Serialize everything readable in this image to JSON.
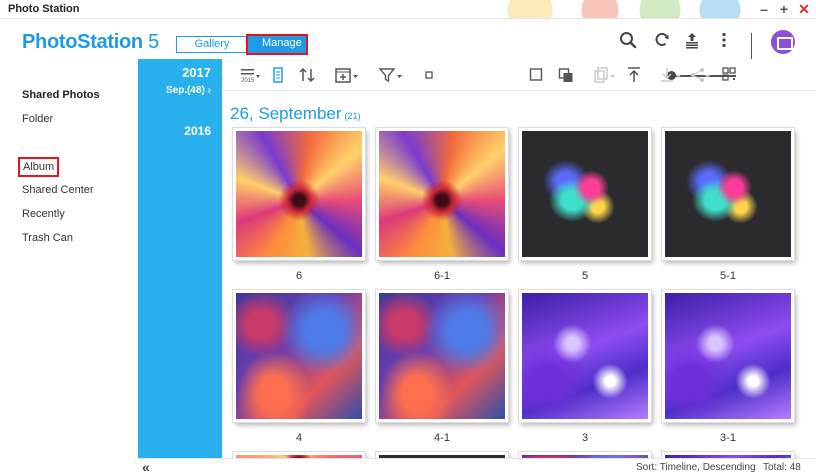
{
  "window": {
    "title": "Photo Station",
    "controls": [
      "–",
      "+",
      "✕"
    ]
  },
  "header": {
    "logo_bold": "PhotoStation",
    "logo_rest": " 5",
    "mode_gallery": "Gallery",
    "mode_manage": "Manage",
    "icons": [
      "search-icon",
      "refresh-icon",
      "upload-icon",
      "more-icon",
      "user-avatar-icon"
    ]
  },
  "sidebar": {
    "items": [
      {
        "label": "Shared Photos"
      },
      {
        "label": "Folder"
      },
      {
        "label": "Album"
      },
      {
        "label": "Shared Center"
      },
      {
        "label": "Recently"
      },
      {
        "label": "Trash Can"
      }
    ]
  },
  "timeline": {
    "year_current": "2017",
    "month_current": "Sep.(48) ›",
    "year_prev": "2016"
  },
  "toolbar": {
    "icons": [
      "date-sort-icon",
      "list-view-icon",
      "sort-order-icon",
      "add-to-album-icon",
      "filter-icon",
      "small-thumb-icon",
      "zoom-slider",
      "large-thumb-icon",
      "multi-select-icon",
      "copy-icon",
      "upload-top-icon",
      "download-icon",
      "share-icon",
      "qr-code-icon"
    ],
    "zoom_level": 0.05
  },
  "content": {
    "date_heading": "26, September",
    "date_count": "(21)",
    "photos": [
      {
        "caption": "6",
        "style": "flower"
      },
      {
        "caption": "6-1",
        "style": "flower"
      },
      {
        "caption": "5",
        "style": "splash"
      },
      {
        "caption": "5-1",
        "style": "splash"
      },
      {
        "caption": "4",
        "style": "fluid"
      },
      {
        "caption": "4-1",
        "style": "fluid"
      },
      {
        "caption": "3",
        "style": "purple"
      },
      {
        "caption": "3-1",
        "style": "purple"
      }
    ]
  },
  "status": {
    "collapse": "«",
    "sort": "Sort: Timeline, Descending",
    "total": "Total: 48"
  },
  "colors": {
    "accent": "#1e9be8",
    "timeline": "#29b1ee",
    "highlight": "#e3161d",
    "avatar": "#8e4fd6"
  }
}
